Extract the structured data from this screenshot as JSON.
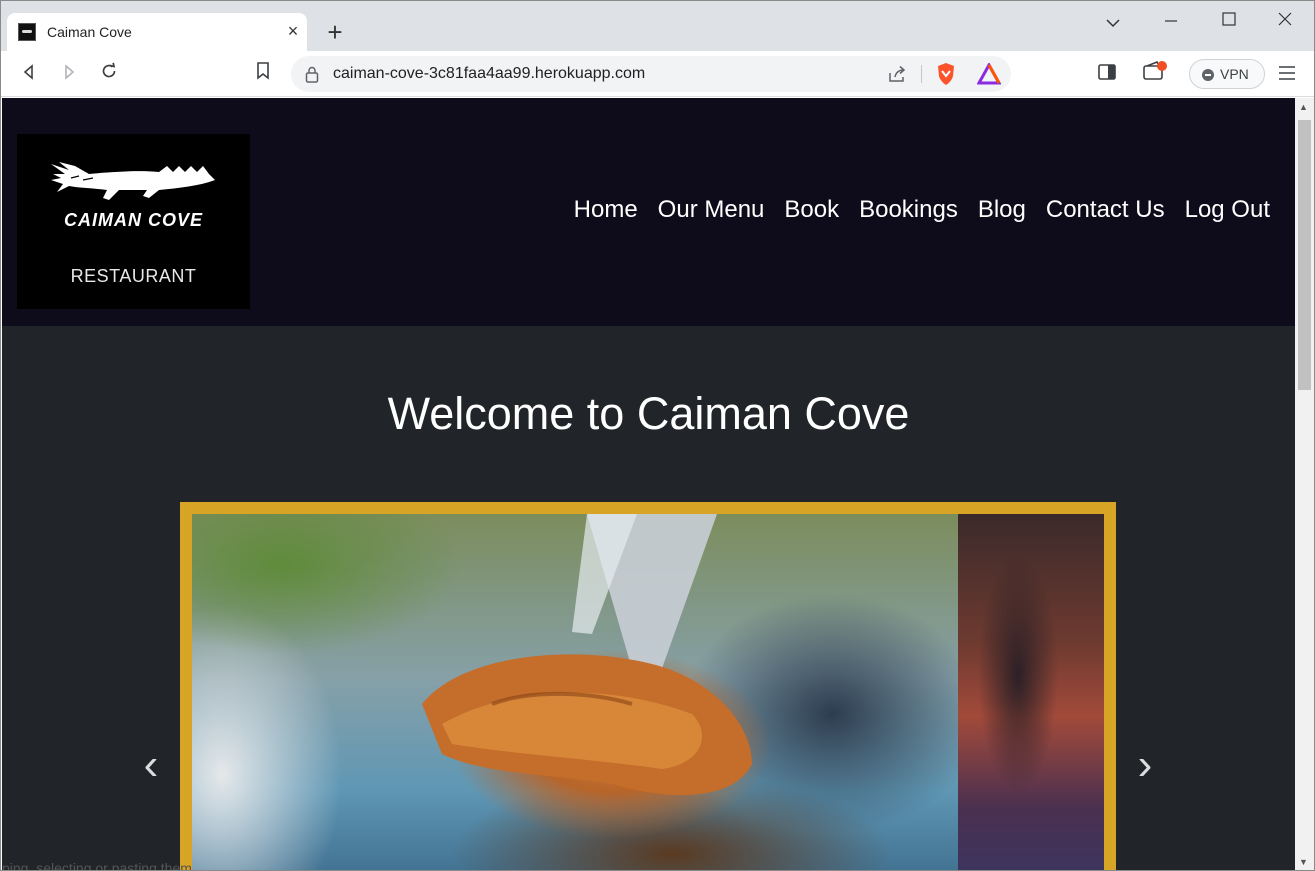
{
  "browser": {
    "tab_title": "Caiman Cove",
    "url": "caiman-cove-3c81faa4aa99.herokuapp.com",
    "vpn_label": "VPN",
    "icons": {
      "close": "×",
      "new_tab": "+",
      "chevron": "⌄",
      "minimize": "—",
      "maximize": "☐",
      "window_close": "✕",
      "back": "◁",
      "forward": "▷",
      "reload": "↻",
      "menu": "≡"
    }
  },
  "site": {
    "logo_name": "CAIMAN COVE",
    "logo_sub": "RESTAURANT",
    "nav": [
      "Home",
      "Our Menu",
      "Book",
      "Bookings",
      "Blog",
      "Contact Us",
      "Log Out"
    ],
    "hero_title": "Welcome to Caiman Cove",
    "carousel_prev": "‹",
    "carousel_next": "›",
    "accent_color": "#d8a425",
    "header_color": "#0e0c1a",
    "page_bg": "#212529"
  },
  "clipped_text": "ping, selecting or pasting them."
}
